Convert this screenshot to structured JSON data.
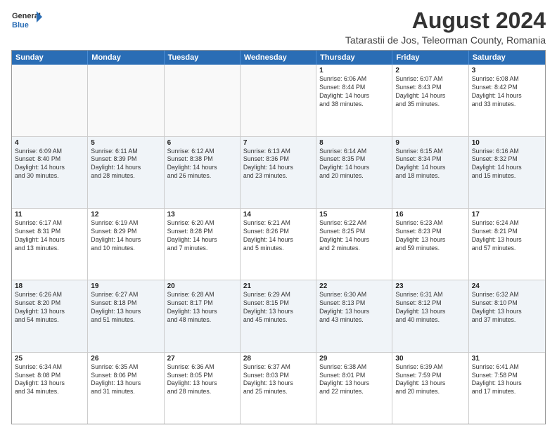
{
  "logo": {
    "general": "General",
    "blue": "Blue"
  },
  "title": "August 2024",
  "location": "Tatarastii de Jos, Teleorman County, Romania",
  "headers": [
    "Sunday",
    "Monday",
    "Tuesday",
    "Wednesday",
    "Thursday",
    "Friday",
    "Saturday"
  ],
  "weeks": [
    [
      {
        "day": "",
        "text": "",
        "empty": true
      },
      {
        "day": "",
        "text": "",
        "empty": true
      },
      {
        "day": "",
        "text": "",
        "empty": true
      },
      {
        "day": "",
        "text": "",
        "empty": true
      },
      {
        "day": "1",
        "text": "Sunrise: 6:06 AM\nSunset: 8:44 PM\nDaylight: 14 hours\nand 38 minutes.",
        "empty": false
      },
      {
        "day": "2",
        "text": "Sunrise: 6:07 AM\nSunset: 8:43 PM\nDaylight: 14 hours\nand 35 minutes.",
        "empty": false
      },
      {
        "day": "3",
        "text": "Sunrise: 6:08 AM\nSunset: 8:42 PM\nDaylight: 14 hours\nand 33 minutes.",
        "empty": false
      }
    ],
    [
      {
        "day": "4",
        "text": "Sunrise: 6:09 AM\nSunset: 8:40 PM\nDaylight: 14 hours\nand 30 minutes.",
        "empty": false
      },
      {
        "day": "5",
        "text": "Sunrise: 6:11 AM\nSunset: 8:39 PM\nDaylight: 14 hours\nand 28 minutes.",
        "empty": false
      },
      {
        "day": "6",
        "text": "Sunrise: 6:12 AM\nSunset: 8:38 PM\nDaylight: 14 hours\nand 26 minutes.",
        "empty": false
      },
      {
        "day": "7",
        "text": "Sunrise: 6:13 AM\nSunset: 8:36 PM\nDaylight: 14 hours\nand 23 minutes.",
        "empty": false
      },
      {
        "day": "8",
        "text": "Sunrise: 6:14 AM\nSunset: 8:35 PM\nDaylight: 14 hours\nand 20 minutes.",
        "empty": false
      },
      {
        "day": "9",
        "text": "Sunrise: 6:15 AM\nSunset: 8:34 PM\nDaylight: 14 hours\nand 18 minutes.",
        "empty": false
      },
      {
        "day": "10",
        "text": "Sunrise: 6:16 AM\nSunset: 8:32 PM\nDaylight: 14 hours\nand 15 minutes.",
        "empty": false
      }
    ],
    [
      {
        "day": "11",
        "text": "Sunrise: 6:17 AM\nSunset: 8:31 PM\nDaylight: 14 hours\nand 13 minutes.",
        "empty": false
      },
      {
        "day": "12",
        "text": "Sunrise: 6:19 AM\nSunset: 8:29 PM\nDaylight: 14 hours\nand 10 minutes.",
        "empty": false
      },
      {
        "day": "13",
        "text": "Sunrise: 6:20 AM\nSunset: 8:28 PM\nDaylight: 14 hours\nand 7 minutes.",
        "empty": false
      },
      {
        "day": "14",
        "text": "Sunrise: 6:21 AM\nSunset: 8:26 PM\nDaylight: 14 hours\nand 5 minutes.",
        "empty": false
      },
      {
        "day": "15",
        "text": "Sunrise: 6:22 AM\nSunset: 8:25 PM\nDaylight: 14 hours\nand 2 minutes.",
        "empty": false
      },
      {
        "day": "16",
        "text": "Sunrise: 6:23 AM\nSunset: 8:23 PM\nDaylight: 13 hours\nand 59 minutes.",
        "empty": false
      },
      {
        "day": "17",
        "text": "Sunrise: 6:24 AM\nSunset: 8:21 PM\nDaylight: 13 hours\nand 57 minutes.",
        "empty": false
      }
    ],
    [
      {
        "day": "18",
        "text": "Sunrise: 6:26 AM\nSunset: 8:20 PM\nDaylight: 13 hours\nand 54 minutes.",
        "empty": false
      },
      {
        "day": "19",
        "text": "Sunrise: 6:27 AM\nSunset: 8:18 PM\nDaylight: 13 hours\nand 51 minutes.",
        "empty": false
      },
      {
        "day": "20",
        "text": "Sunrise: 6:28 AM\nSunset: 8:17 PM\nDaylight: 13 hours\nand 48 minutes.",
        "empty": false
      },
      {
        "day": "21",
        "text": "Sunrise: 6:29 AM\nSunset: 8:15 PM\nDaylight: 13 hours\nand 45 minutes.",
        "empty": false
      },
      {
        "day": "22",
        "text": "Sunrise: 6:30 AM\nSunset: 8:13 PM\nDaylight: 13 hours\nand 43 minutes.",
        "empty": false
      },
      {
        "day": "23",
        "text": "Sunrise: 6:31 AM\nSunset: 8:12 PM\nDaylight: 13 hours\nand 40 minutes.",
        "empty": false
      },
      {
        "day": "24",
        "text": "Sunrise: 6:32 AM\nSunset: 8:10 PM\nDaylight: 13 hours\nand 37 minutes.",
        "empty": false
      }
    ],
    [
      {
        "day": "25",
        "text": "Sunrise: 6:34 AM\nSunset: 8:08 PM\nDaylight: 13 hours\nand 34 minutes.",
        "empty": false
      },
      {
        "day": "26",
        "text": "Sunrise: 6:35 AM\nSunset: 8:06 PM\nDaylight: 13 hours\nand 31 minutes.",
        "empty": false
      },
      {
        "day": "27",
        "text": "Sunrise: 6:36 AM\nSunset: 8:05 PM\nDaylight: 13 hours\nand 28 minutes.",
        "empty": false
      },
      {
        "day": "28",
        "text": "Sunrise: 6:37 AM\nSunset: 8:03 PM\nDaylight: 13 hours\nand 25 minutes.",
        "empty": false
      },
      {
        "day": "29",
        "text": "Sunrise: 6:38 AM\nSunset: 8:01 PM\nDaylight: 13 hours\nand 22 minutes.",
        "empty": false
      },
      {
        "day": "30",
        "text": "Sunrise: 6:39 AM\nSunset: 7:59 PM\nDaylight: 13 hours\nand 20 minutes.",
        "empty": false
      },
      {
        "day": "31",
        "text": "Sunrise: 6:41 AM\nSunset: 7:58 PM\nDaylight: 13 hours\nand 17 minutes.",
        "empty": false
      }
    ]
  ]
}
